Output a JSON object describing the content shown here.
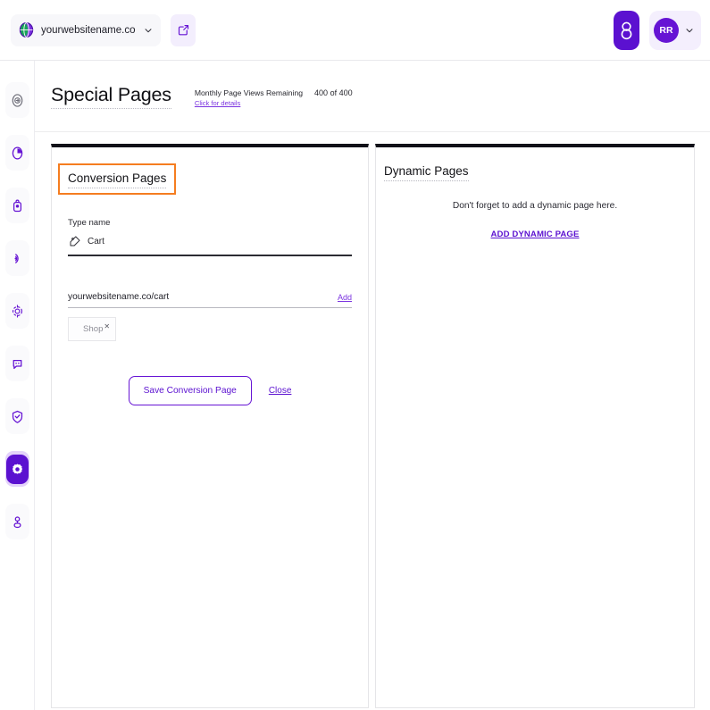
{
  "topbar": {
    "site_name": "yourwebsitename.co",
    "globe_icon": "globe-icon",
    "chevron_icon": "chevron-down-icon",
    "external_link_icon": "external-link-icon",
    "logo_icon": "brand-logo-icon",
    "avatar_initials": "RR",
    "avatar_chevron_icon": "chevron-down-icon",
    "accent_purple": "#5b11d0",
    "logo_bg": "#5b11d0",
    "avatar_bg": "#6614d4"
  },
  "sidebar": {
    "items": [
      {
        "name": "sidebar-item-dashboard",
        "icon": "arrow-right-circle-icon",
        "active": false,
        "tint": true
      },
      {
        "name": "sidebar-item-analytics",
        "icon": "pie-chart-icon",
        "active": false,
        "tint": true
      },
      {
        "name": "sidebar-item-commerce",
        "icon": "shopping-bag-icon",
        "active": false,
        "tint": true
      },
      {
        "name": "sidebar-item-signals",
        "icon": "signal-wave-icon",
        "active": false,
        "tint": true
      },
      {
        "name": "sidebar-item-targeting",
        "icon": "target-crosshair-icon",
        "active": false,
        "tint": true
      },
      {
        "name": "sidebar-item-messages",
        "icon": "chat-bubble-icon",
        "active": false,
        "tint": true
      },
      {
        "name": "sidebar-item-protection",
        "icon": "shield-check-icon",
        "active": false,
        "tint": true
      },
      {
        "name": "sidebar-item-settings",
        "icon": "gear-icon",
        "active": true,
        "tint": false
      },
      {
        "name": "sidebar-item-account",
        "icon": "user-pin-icon",
        "active": false,
        "tint": true
      }
    ],
    "active_bg": "#e3d2fa",
    "active_pill_bg": "#5b11d0"
  },
  "header": {
    "title": "Special Pages",
    "quota_label": "Monthly Page Views Remaining",
    "quota_link": "Click for details",
    "quota_count": "400 of 400",
    "quota_percent": 0
  },
  "conversion_panel": {
    "title": "Conversion Pages",
    "highlight_color": "#f57d20",
    "name_field_label": "Type name",
    "name_field_icon": "tag-icon",
    "name_field_value": "Cart",
    "url_value": "yourwebsitename.co/cart",
    "add_label": "Add",
    "chip_label": "Shop",
    "chip_remove_icon": "close-icon",
    "save_label": "Save Conversion Page",
    "close_label": "Close"
  },
  "dynamic_panel": {
    "title": "Dynamic Pages",
    "empty_message": "Don't forget to add a dynamic page here.",
    "add_label": "ADD DYNAMIC PAGE"
  }
}
